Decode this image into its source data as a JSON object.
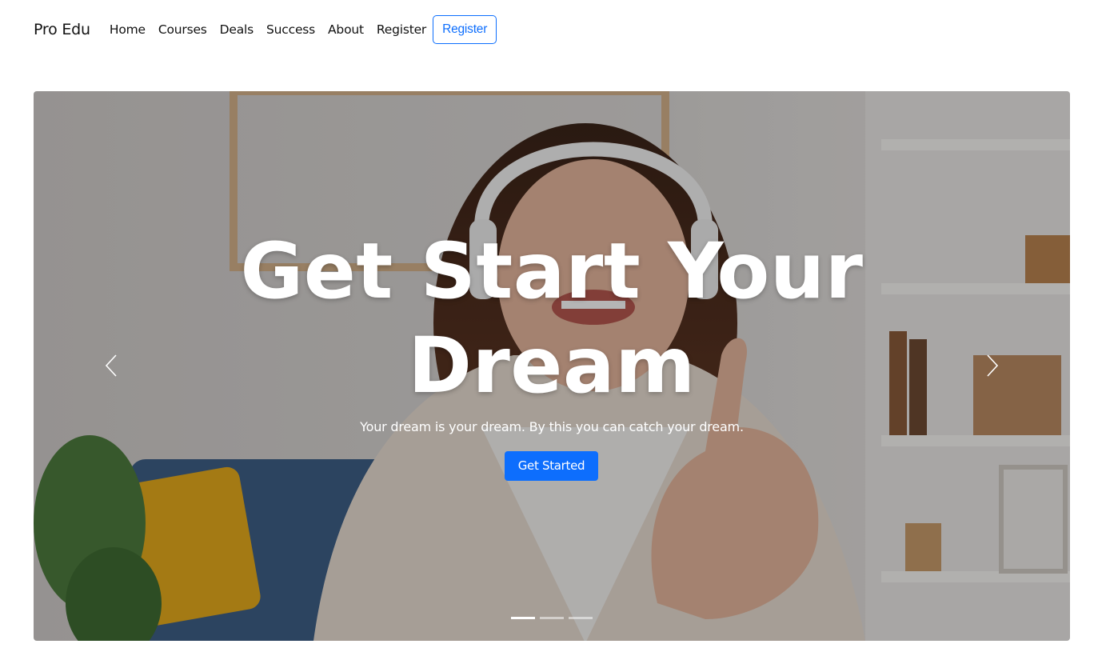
{
  "nav": {
    "brand": "Pro Edu",
    "links": [
      "Home",
      "Courses",
      "Deals",
      "Success",
      "About",
      "Register"
    ],
    "register_button": "Register"
  },
  "hero": {
    "title_line1": "Get Start Your",
    "title_line2": "Dream",
    "subtitle": "Your dream is your dream. By this you can catch your dream.",
    "cta": "Get Started",
    "slide_count": 3,
    "active_slide": 1
  },
  "colors": {
    "primary": "#0d6efd",
    "text": "#111111"
  },
  "icons": {
    "prev": "chevron-left-icon",
    "next": "chevron-right-icon"
  }
}
